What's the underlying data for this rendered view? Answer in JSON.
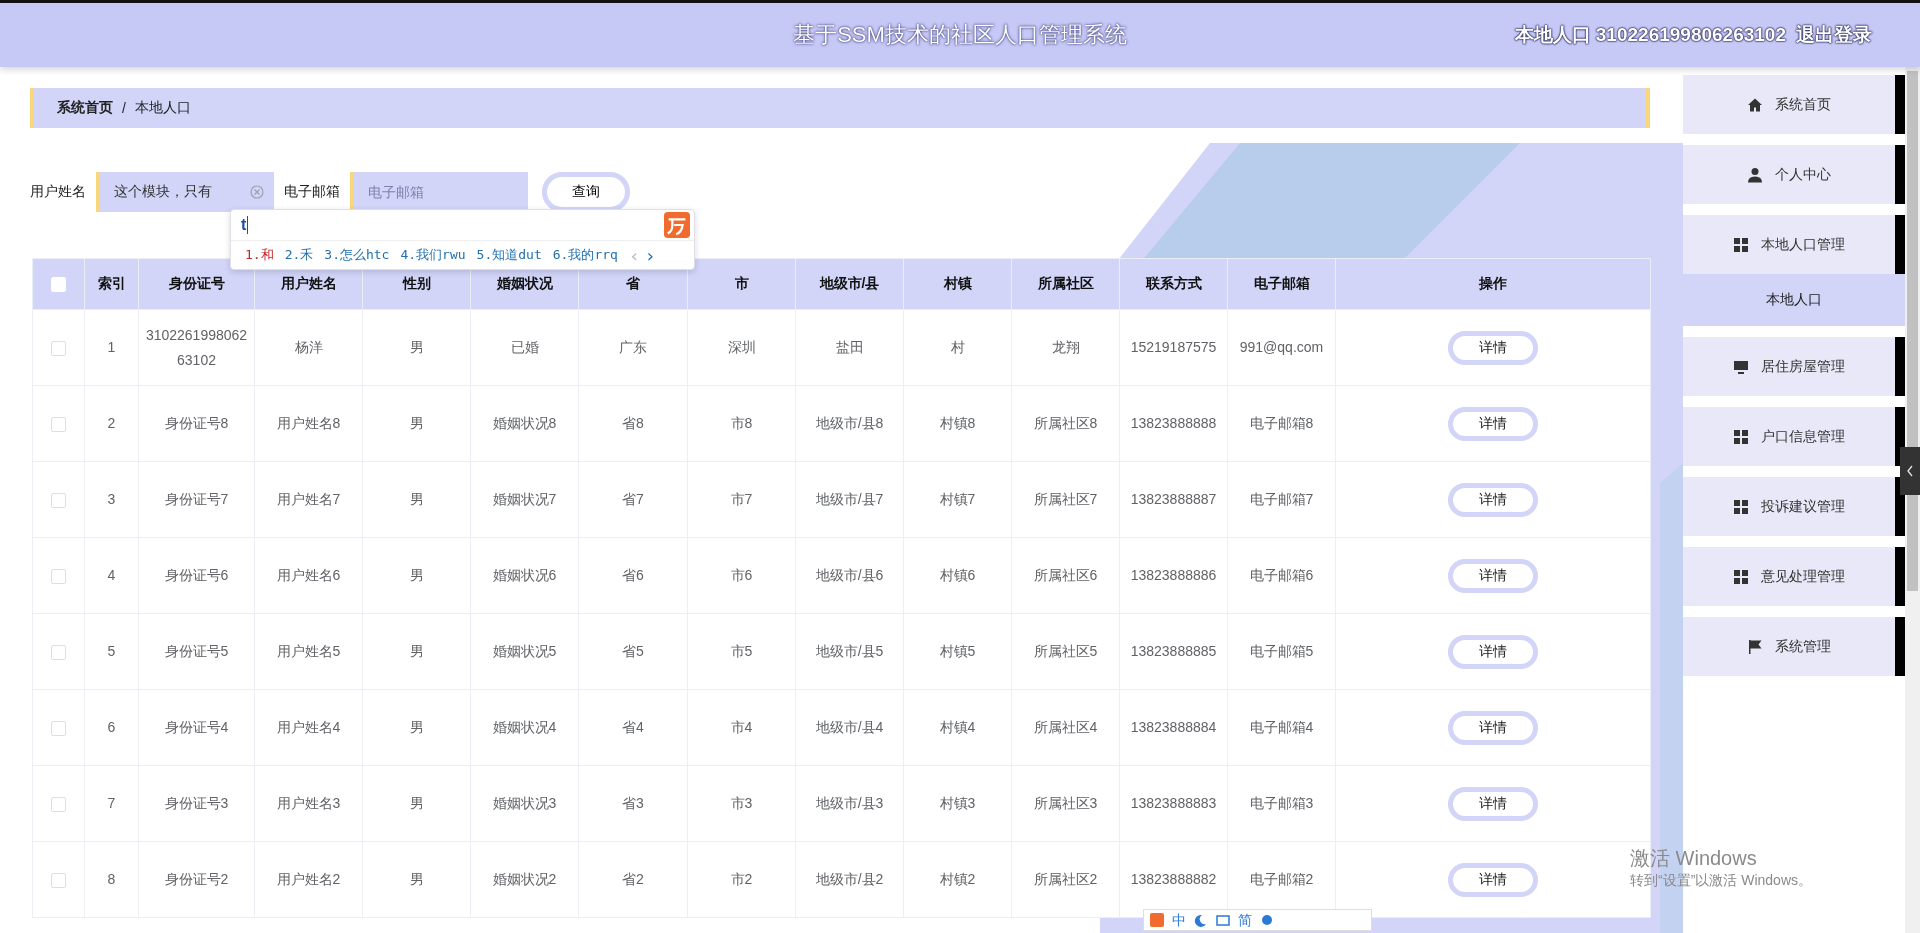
{
  "header": {
    "title": "基于SSM技术的社区人口管理系统",
    "user": "本地人口 310226199806263102",
    "logout": "退出登录"
  },
  "breadcrumb": [
    "系统首页",
    "/",
    "本地人口"
  ],
  "filters": [
    {
      "label": "用户姓名",
      "value": "这个模块，只有"
    },
    {
      "label": "电子邮箱",
      "placeholder": "电子邮箱"
    }
  ],
  "search_button": "查询",
  "ime": {
    "composition": "t",
    "candidates": [
      "1.和",
      "2.禾",
      "3.怎么htc",
      "4.我们rwu",
      "5.知道dut",
      "6.我的rrq"
    ],
    "prev": "‹",
    "next": "›"
  },
  "table": {
    "select_all": {
      "checked": false
    },
    "columns": [
      "索引",
      "身份证号",
      "用户姓名",
      "性别",
      "婚姻状况",
      "省",
      "市",
      "地级市/县",
      "村镇",
      "所属社区",
      "联系方式",
      "电子邮箱",
      "操作"
    ],
    "rows": [
      {
        "checked": false,
        "cells": [
          "1",
          "310226199806263102",
          "杨洋",
          "男",
          "已婚",
          "广东",
          "深圳",
          "盐田",
          "村",
          "龙翔",
          "15219187575",
          "991@qq.com"
        ],
        "action": "详情"
      },
      {
        "checked": false,
        "cells": [
          "2",
          "身份证号8",
          "用户姓名8",
          "男",
          "婚姻状况8",
          "省8",
          "市8",
          "地级市/县8",
          "村镇8",
          "所属社区8",
          "13823888888",
          "电子邮箱8"
        ],
        "action": "详情"
      },
      {
        "checked": false,
        "cells": [
          "3",
          "身份证号7",
          "用户姓名7",
          "男",
          "婚姻状况7",
          "省7",
          "市7",
          "地级市/县7",
          "村镇7",
          "所属社区7",
          "13823888887",
          "电子邮箱7"
        ],
        "action": "详情"
      },
      {
        "checked": false,
        "cells": [
          "4",
          "身份证号6",
          "用户姓名6",
          "男",
          "婚姻状况6",
          "省6",
          "市6",
          "地级市/县6",
          "村镇6",
          "所属社区6",
          "13823888886",
          "电子邮箱6"
        ],
        "action": "详情"
      },
      {
        "checked": false,
        "cells": [
          "5",
          "身份证号5",
          "用户姓名5",
          "男",
          "婚姻状况5",
          "省5",
          "市5",
          "地级市/县5",
          "村镇5",
          "所属社区5",
          "13823888885",
          "电子邮箱5"
        ],
        "action": "详情"
      },
      {
        "checked": false,
        "cells": [
          "6",
          "身份证号4",
          "用户姓名4",
          "男",
          "婚姻状况4",
          "省4",
          "市4",
          "地级市/县4",
          "村镇4",
          "所属社区4",
          "13823888884",
          "电子邮箱4"
        ],
        "action": "详情"
      },
      {
        "checked": false,
        "cells": [
          "7",
          "身份证号3",
          "用户姓名3",
          "男",
          "婚姻状况3",
          "省3",
          "市3",
          "地级市/县3",
          "村镇3",
          "所属社区3",
          "13823888883",
          "电子邮箱3"
        ],
        "action": "详情"
      },
      {
        "checked": false,
        "cells": [
          "8",
          "身份证号2",
          "用户姓名2",
          "男",
          "婚姻状况2",
          "省2",
          "市2",
          "地级市/县2",
          "村镇2",
          "所属社区2",
          "13823888882",
          "电子邮箱2"
        ],
        "action": "详情"
      }
    ]
  },
  "sidebar": {
    "items": [
      {
        "kind": "home",
        "label": "系统首页"
      },
      {
        "kind": "user",
        "label": "个人中心"
      },
      {
        "kind": "grid",
        "label": "本地人口管理",
        "children": [
          {
            "label": "本地人口",
            "selected": true
          }
        ]
      },
      {
        "kind": "monitor",
        "label": "居住房屋管理"
      },
      {
        "kind": "grid",
        "label": "户口信息管理"
      },
      {
        "kind": "grid",
        "label": "投诉建议管理"
      },
      {
        "kind": "grid",
        "label": "意见处理管理"
      },
      {
        "kind": "flag",
        "label": "系统管理"
      }
    ]
  },
  "ime_toolbar": [
    "中",
    "简"
  ],
  "activation": {
    "title": "激活 Windows",
    "hint": "转到“设置”以激活 Windows。"
  }
}
